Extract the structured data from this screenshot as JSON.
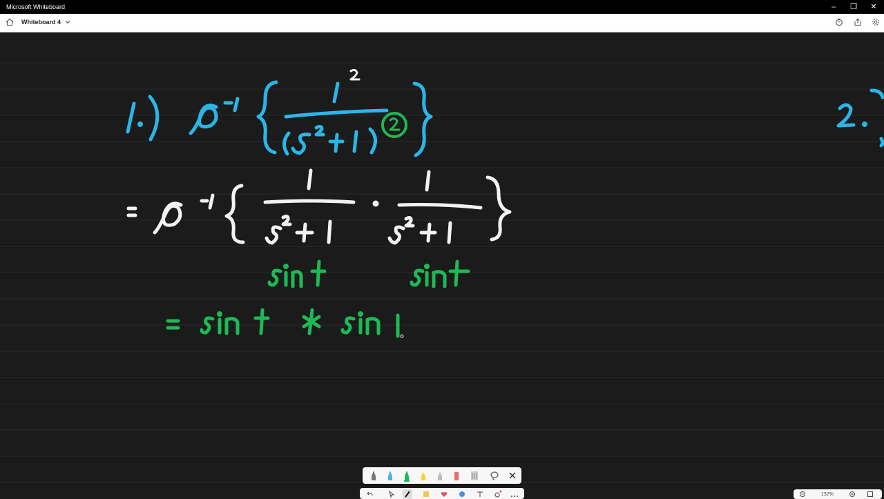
{
  "window": {
    "title": "Microsoft Whiteboard",
    "minimize_icon": "minimize-icon",
    "restore_icon": "restore-icon",
    "close_icon": "close-icon"
  },
  "appbar": {
    "board_name": "Whiteboard 4",
    "home_icon": "home-icon",
    "dropdown_icon": "chevron-down-icon",
    "timer_icon": "timer-icon",
    "share_icon": "share-icon",
    "settings_icon": "settings-icon"
  },
  "canvas": {
    "background": "#1b1b1b",
    "ink_colors": {
      "blue": "#29b6e8",
      "white": "#f2f2f2",
      "green": "#1db954"
    }
  },
  "toolbar": {
    "tools": [
      "pen-icon",
      "highlighter-icon",
      "pen-green-icon",
      "highlighter-yellow-icon",
      "eraser-icon",
      "marker-red-icon",
      "ruler-icon",
      "lasso-icon",
      "close-icon"
    ]
  },
  "bottom_toolbar": {
    "undo_icon": "undo-icon",
    "select_icon": "select-icon",
    "pen_icon": "pen-icon",
    "note_icon": "note-icon",
    "reaction_icon": "reaction-icon",
    "shape_icon": "shape-icon",
    "text_icon": "text-icon",
    "more_icon": "more-icon"
  },
  "zoom": {
    "value": "132%",
    "zoom_out_icon": "zoom-out-icon",
    "zoom_in_icon": "zoom-in-icon",
    "fit_icon": "fit-icon"
  }
}
